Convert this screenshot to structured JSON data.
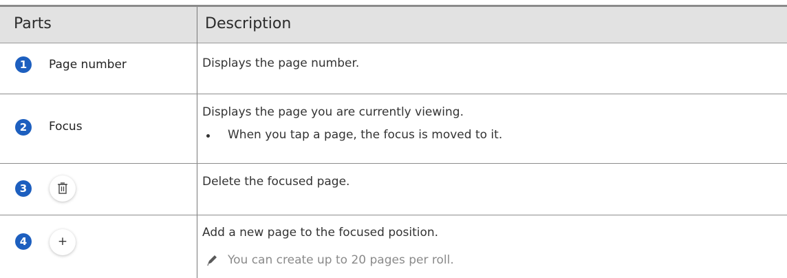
{
  "table": {
    "header": {
      "parts": "Parts",
      "description": "Description"
    },
    "rows": [
      {
        "number": "1",
        "part_label": "Page number",
        "description": "Displays the page number."
      },
      {
        "number": "2",
        "part_label": "Focus",
        "description": "Displays the page you are currently viewing.",
        "bullet": "When you tap a page, the focus is moved to it."
      },
      {
        "number": "3",
        "part_icon": "trash-icon",
        "description": "Delete the focused page."
      },
      {
        "number": "4",
        "part_icon": "plus-icon",
        "icon_glyph": "+",
        "description": "Add a new page to the focused position.",
        "note": "You can create up to 20 pages per roll.",
        "note_icon": "pencil-icon"
      }
    ]
  },
  "colors": {
    "badge": "#1d5fbf",
    "header_bg": "#e2e2e2",
    "note_text": "#8a8a8a"
  }
}
